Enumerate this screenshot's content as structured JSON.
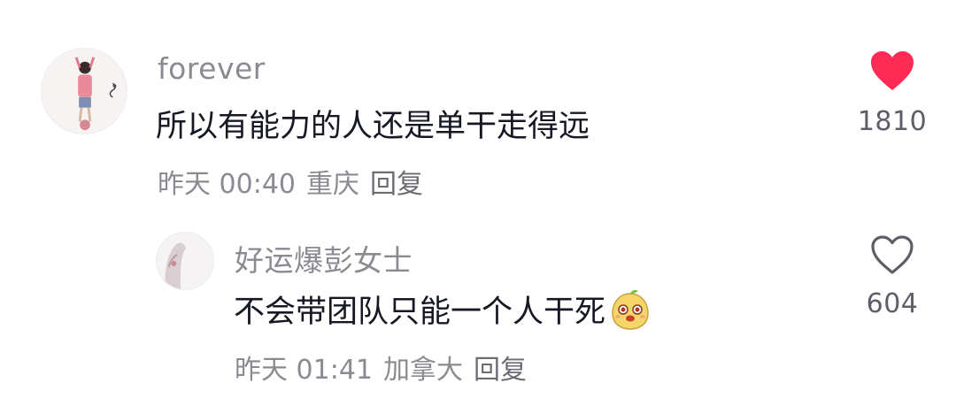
{
  "comments": [
    {
      "username": "forever",
      "text": "所以有能力的人还是单干走得远",
      "time": "昨天 00:40",
      "location": "重庆",
      "reply_label": "回复",
      "likes": "1810",
      "liked": true,
      "avatar_icon": "avatar-photo-icon"
    },
    {
      "username": "好运爆彭女士",
      "text": "不会带团队只能一个人干死",
      "emoji_icon": "mango-face-emoji-icon",
      "time": "昨天 01:41",
      "location": "加拿大",
      "reply_label": "回复",
      "likes": "604",
      "liked": false,
      "avatar_icon": "avatar-photo-icon"
    }
  ],
  "colors": {
    "like_active": "#fe2c55",
    "secondary_text": "#8a8b91",
    "primary_text": "#161823"
  }
}
